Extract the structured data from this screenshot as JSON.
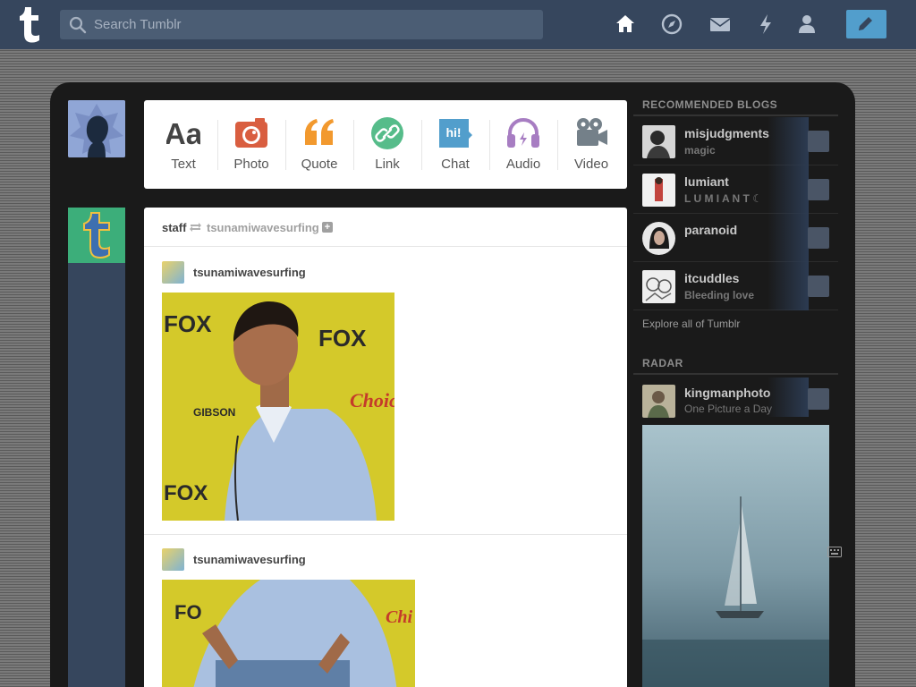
{
  "header": {
    "search_placeholder": "Search Tumblr",
    "icons": [
      "home-icon",
      "explore-icon",
      "inbox-icon",
      "activity-icon",
      "account-icon",
      "compose-icon"
    ]
  },
  "post_types": [
    {
      "label": "Text",
      "glyph": "Aa",
      "color": "#444444"
    },
    {
      "label": "Photo",
      "color": "#d95e40"
    },
    {
      "label": "Quote",
      "color": "#f2992e"
    },
    {
      "label": "Link",
      "color": "#56bc8a"
    },
    {
      "label": "Chat",
      "glyph": "hi!",
      "color": "#529ecc"
    },
    {
      "label": "Audio",
      "color": "#a77dc2"
    },
    {
      "label": "Video",
      "color": "#748089"
    }
  ],
  "post": {
    "reblogger": "staff",
    "source": "tsunamiwavesurfing",
    "plus": "+",
    "trail": [
      {
        "name": "tsunamiwavesurfing"
      },
      {
        "name": "tsunamiwavesurfing"
      }
    ]
  },
  "sidebar": {
    "recommended_title": "RECOMMENDED BLOGS",
    "blogs": [
      {
        "name": "misjudgments",
        "sub": "magic"
      },
      {
        "name": "lumiant",
        "sub": "L U M I A N T ☾"
      },
      {
        "name": "paranoid",
        "sub": ""
      },
      {
        "name": "itcuddles",
        "sub": "Bleeding love"
      }
    ],
    "explore": "Explore all of Tumblr",
    "radar_title": "RADAR",
    "radar_blog": {
      "name": "kingmanphoto",
      "sub": "One Picture a Day"
    }
  }
}
